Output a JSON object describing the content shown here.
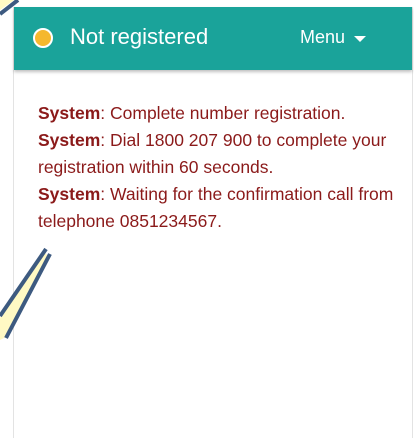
{
  "header": {
    "status_color": "#f5b82e",
    "status_text": "Not registered",
    "menu_label": "Menu",
    "menu_icon": "caret-down-icon",
    "background_color": "#1aa39a"
  },
  "messages": [
    {
      "sender": "System",
      "separator": ": ",
      "text": "Complete number registration."
    },
    {
      "sender": "System",
      "separator": ": ",
      "text": "Dial 1800 207 900 to complete your registration within 60 seconds."
    },
    {
      "sender": "System",
      "separator": ": ",
      "text": "Waiting for the confirmation call from telephone 0851234567."
    }
  ],
  "text_color": "#8b1a1a"
}
